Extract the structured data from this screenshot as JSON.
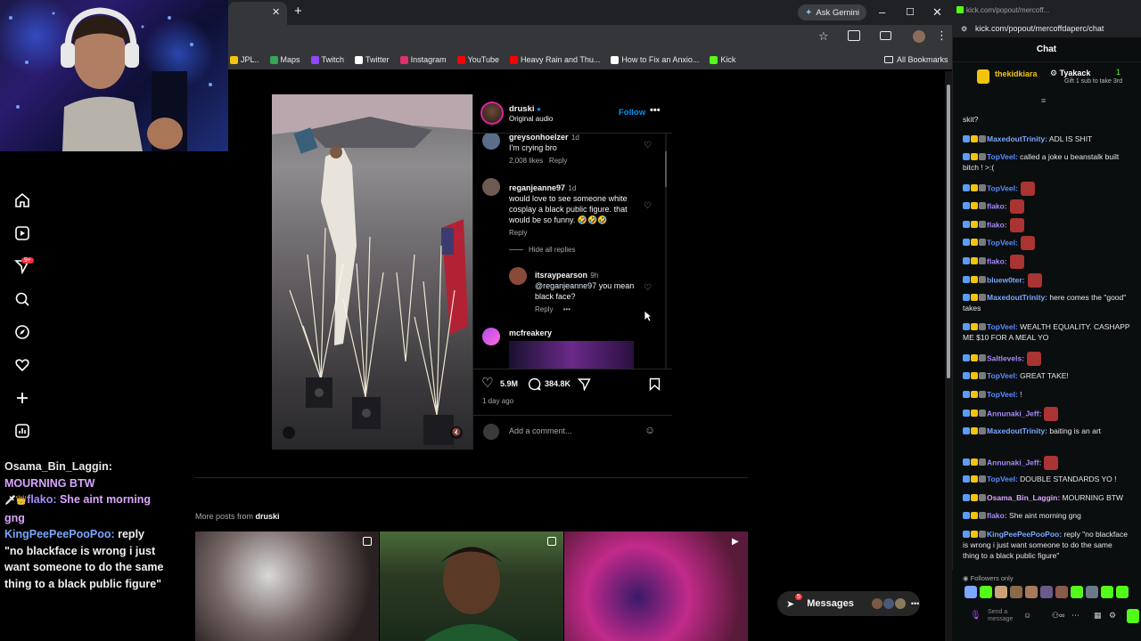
{
  "browser": {
    "ask_gemini": "Ask Gemini",
    "bookmarks": [
      {
        "label": "JPL..",
        "color": "#f1c40f"
      },
      {
        "label": "Maps",
        "color": "#34a853"
      },
      {
        "label": "Twitch",
        "color": "#9146ff"
      },
      {
        "label": "Twitter",
        "color": "#ffffff"
      },
      {
        "label": "Instagram",
        "color": "#e1306c"
      },
      {
        "label": "YouTube",
        "color": "#ff0000"
      },
      {
        "label": "Heavy Rain and Thu...",
        "color": "#ff0000"
      },
      {
        "label": "How to Fix an Anxio...",
        "color": "#ffffff"
      },
      {
        "label": "Kick",
        "color": "#53fc18"
      }
    ],
    "all_bookmarks": "All Bookmarks"
  },
  "post": {
    "author": "druski",
    "audio": "Original audio",
    "follow": "Follow",
    "comments": [
      {
        "user": "greysonhoelzer",
        "time": "1d",
        "text": "I'm crying bro",
        "likes": "2,008 likes",
        "reply": "Reply"
      },
      {
        "user": "reganjeanne97",
        "time": "1d",
        "text": "would love to see someone white cosplay a black public figure. that would be so funny. 🤣🤣🤣",
        "reply": "Reply"
      },
      {
        "hide": "Hide all replies"
      },
      {
        "user": "itsraypearson",
        "time": "9h",
        "mention": "@reganjeanne97",
        "text": " you mean black face?",
        "reply": "Reply"
      },
      {
        "user": "mcfreakery"
      }
    ],
    "likes": "5.9M",
    "comment_count": "384.8K",
    "age": "1 day ago",
    "add_comment_placeholder": "Add a comment..."
  },
  "more_posts": {
    "label_prefix": "More posts from ",
    "author": "druski"
  },
  "messages_label": "Messages",
  "messages_count": "5",
  "overlay_chat": [
    {
      "name": "Osama_Bin_Laggin:",
      "color": "#e6e6e6",
      "text": " MOURNING BTW"
    },
    {
      "name": "flako:",
      "color": "#a78bfa",
      "text": " She aint morning gng"
    },
    {
      "name": "KingPeePeePooPoo:",
      "color": "#7aa7ff",
      "text": " reply \"no blackface is wrong i just want someone to do the same thing to a black public figure\""
    }
  ],
  "kick": {
    "tab_url": "kick.com/popout/mercoff...",
    "url": "kick.com/popout/mercoffdaperc/chat",
    "header": "Chat",
    "pinned_user": "thekidkiara",
    "pinned_gifter": "Tyakack",
    "pinned_count": "1",
    "pinned_note": "Gift 1 sub to take 3rd",
    "messages": [
      {
        "name": "",
        "text": "skit?",
        "color": "#e6e6e6"
      },
      {
        "name": "MaxedoutTrinity:",
        "text": " ADL IS SHIT",
        "color": "#7aa7ff"
      },
      {
        "name": "TopVeel:",
        "text": " called a joke u beanstalk built bitch ! >:(",
        "color": "#5b8cff"
      },
      {
        "name": "TopVeel:",
        "text": "",
        "color": "#5b8cff"
      },
      {
        "name": "flako:",
        "text": "",
        "color": "#a78bfa"
      },
      {
        "name": "flako:",
        "text": "",
        "color": "#a78bfa"
      },
      {
        "name": "TopVeel:",
        "text": "",
        "color": "#5b8cff"
      },
      {
        "name": "flako:",
        "text": "",
        "color": "#a78bfa"
      },
      {
        "name": "bluew0ter:",
        "text": "",
        "color": "#7aa7ff"
      },
      {
        "name": "MaxedoutTrinity:",
        "text": " here comes the \"good\" takes",
        "color": "#7aa7ff"
      },
      {
        "name": "TopVeel:",
        "text": " WEALTH EQUALITY. CASHAPP ME $10 FOR A MEAL YO",
        "color": "#5b8cff"
      },
      {
        "name": "Saltlevels:",
        "text": "",
        "color": "#a78bfa"
      },
      {
        "name": "TopVeel:",
        "text": " GREAT TAKE!",
        "color": "#5b8cff"
      },
      {
        "name": "TopVeel:",
        "text": " !",
        "color": "#5b8cff"
      },
      {
        "name": "Annunaki_Jeff:",
        "text": "",
        "color": "#a78bfa"
      },
      {
        "name": "MaxedoutTrinity:",
        "text": " baiting is an art",
        "color": "#7aa7ff"
      },
      {
        "name": "Annunaki_Jeff:",
        "text": "",
        "color": "#a78bfa"
      },
      {
        "name": "TopVeel:",
        "text": " DOUBLE STANDARDS YO !",
        "color": "#5b8cff"
      },
      {
        "name": "Osama_Bin_Laggin:",
        "text": " MOURNING BTW",
        "color": "#d9a6ff"
      },
      {
        "name": "flako:",
        "text": " She aint morning gng",
        "color": "#a78bfa"
      },
      {
        "name": "KingPeePeePooPoo:",
        "text": " reply \"no blackface is wrong i just want someone to do the same thing to a black public figure\"",
        "color": "#7aa7ff"
      }
    ],
    "followers_only": "Followers only",
    "send_placeholder": "Send a message"
  }
}
